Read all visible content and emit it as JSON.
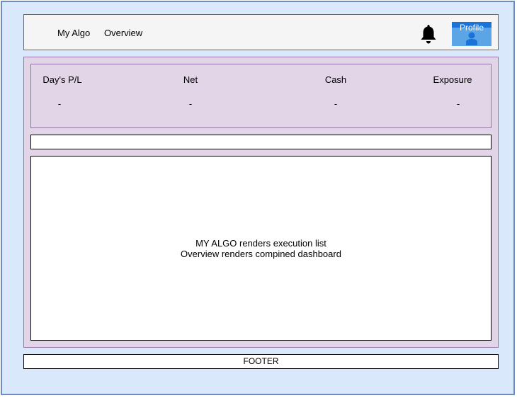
{
  "header": {
    "nav": {
      "my_algo": "My Algo",
      "overview": "Overview"
    },
    "bell_icon": "bell-icon",
    "profile": {
      "label": "Profile",
      "icon": "user-icon",
      "color": "#5ba4e6"
    }
  },
  "stats": {
    "items": [
      {
        "label": "Day's P/L",
        "value": "-"
      },
      {
        "label": "Net",
        "value": "-"
      },
      {
        "label": "Cash",
        "value": "-"
      },
      {
        "label": "Exposure",
        "value": "-"
      }
    ]
  },
  "content": {
    "line1": "MY ALGO renders execution list",
    "line2": "Overview renders compined dashboard"
  },
  "footer": {
    "label": "FOOTER"
  },
  "colors": {
    "page_bg": "#dae8fc",
    "main_bg": "#e1d5e7",
    "header_bg": "#f5f5f5"
  }
}
